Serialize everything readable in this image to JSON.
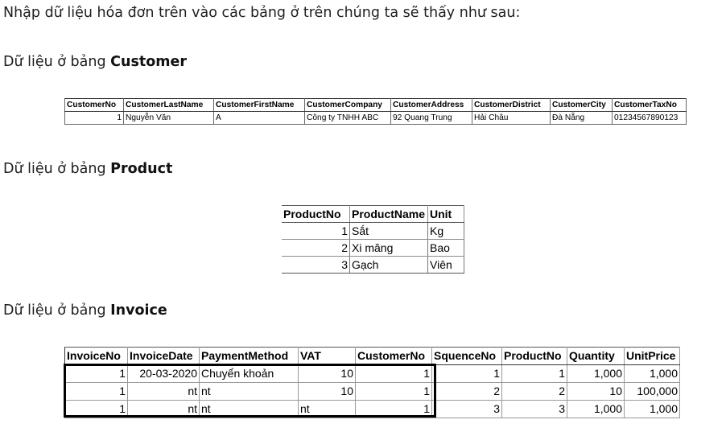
{
  "intro": "Nhập dữ liệu hóa đơn trên vào các bảng ở trên chúng ta sẽ thấy như sau:",
  "sections": {
    "customer": {
      "prefix": "Dữ liệu ở bảng ",
      "name": "Customer"
    },
    "product": {
      "prefix": "Dữ liệu ở bảng ",
      "name": "Product"
    },
    "invoice": {
      "prefix": "Dữ liệu ở bảng ",
      "name": "Invoice"
    }
  },
  "customer_table": {
    "headers": [
      "CustomerNo",
      "CustomerLastName",
      "CustomerFirstName",
      "CustomerCompany",
      "CustomerAddress",
      "CustomerDistrict",
      "CustomerCity",
      "CustomerTaxNo"
    ],
    "row": [
      "1",
      "Nguyễn Văn",
      "A",
      "Công ty TNHH ABC",
      "92 Quang Trung",
      "Hải Châu",
      "Đà Nẵng",
      "01234567890123"
    ]
  },
  "product_table": {
    "headers": [
      "ProductNo",
      "ProductName",
      "Unit"
    ],
    "rows": [
      [
        "1",
        "Sắt",
        "Kg"
      ],
      [
        "2",
        "Xi măng",
        "Bao"
      ],
      [
        "3",
        "Gạch",
        "Viên"
      ]
    ]
  },
  "invoice_table": {
    "headers": [
      "InvoiceNo",
      "InvoiceDate",
      "PaymentMethod",
      "VAT",
      "CustomerNo",
      "SquenceNo",
      "ProductNo",
      "Quantity",
      "UnitPrice"
    ],
    "rows": [
      [
        "1",
        "20-03-2020",
        "Chuyển khoản",
        "10",
        "1",
        "1",
        "1",
        "1,000",
        "1,000"
      ],
      [
        "1",
        "nt",
        "nt",
        "10",
        "1",
        "2",
        "2",
        "10",
        "100,000"
      ],
      [
        "1",
        "nt",
        "nt",
        "nt",
        "1",
        "3",
        "3",
        "1,000",
        "1,000"
      ]
    ]
  }
}
